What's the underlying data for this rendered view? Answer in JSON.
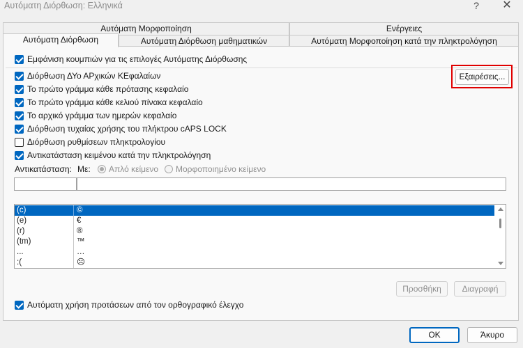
{
  "window": {
    "title": "Αυτόματη Διόρθωση: Ελληνικά",
    "help": "?",
    "close": "✕"
  },
  "tabs": {
    "top": [
      {
        "label": "Αυτόματη Μορφοποίηση"
      },
      {
        "label": "Ενέργειες"
      }
    ],
    "bottom": [
      {
        "label": "Αυτόματη Διόρθωση",
        "active": true
      },
      {
        "label": "Αυτόματη Διόρθωση μαθηματικών"
      },
      {
        "label": "Αυτόματη Μορφοποίηση κατά την πληκτρολόγηση"
      }
    ]
  },
  "options": {
    "show_buttons": {
      "label": "Εμφάνιση κουμπιών για τις επιλογές Αυτόματης Διόρθωσης",
      "checked": true
    },
    "two_initials": {
      "label": "Διόρθωση ΔΥο ΑΡχικών ΚΕφαλαίων",
      "checked": true
    },
    "first_sentence": {
      "label": "Το πρώτο γράμμα κάθε πρότασης κεφαλαίο",
      "checked": true
    },
    "first_cell": {
      "label": "Το πρώτο γράμμα κάθε κελιού πίνακα κεφαλαίο",
      "checked": true
    },
    "day_names": {
      "label": "Το αρχικό γράμμα των ημερών κεφαλαίο",
      "checked": true
    },
    "caps_lock": {
      "label": "Διόρθωση τυχαίας χρήσης του πλήκτρου cAPS LOCK",
      "checked": true
    },
    "keyboard": {
      "label": "Διόρθωση ρυθμίσεων πληκτρολογίου",
      "checked": false
    },
    "replace_text": {
      "label": "Αντικατάσταση κειμένου κατά την πληκτρολόγηση",
      "checked": true
    },
    "spelling": {
      "label": "Αυτόματη χρήση προτάσεων από τον ορθογραφικό έλεγχο",
      "checked": true
    }
  },
  "buttons": {
    "exceptions": "Εξαιρέσεις...",
    "add": "Προσθήκη",
    "delete": "Διαγραφή",
    "ok": "OK",
    "cancel": "Άκυρο"
  },
  "replace": {
    "label": "Αντικατάσταση:",
    "with_label": "Με:",
    "plain_text": "Απλό κείμενο",
    "formatted_text": "Μορφοποιημένο κείμενο",
    "replace_value": "",
    "with_value": ""
  },
  "entries": [
    {
      "from": "(c)",
      "to": "©",
      "selected": true
    },
    {
      "from": "(e)",
      "to": "€"
    },
    {
      "from": "(r)",
      "to": "®"
    },
    {
      "from": "(tm)",
      "to": "™"
    },
    {
      "from": "...",
      "to": "…"
    },
    {
      "from": ":(",
      "to": "☹"
    }
  ]
}
